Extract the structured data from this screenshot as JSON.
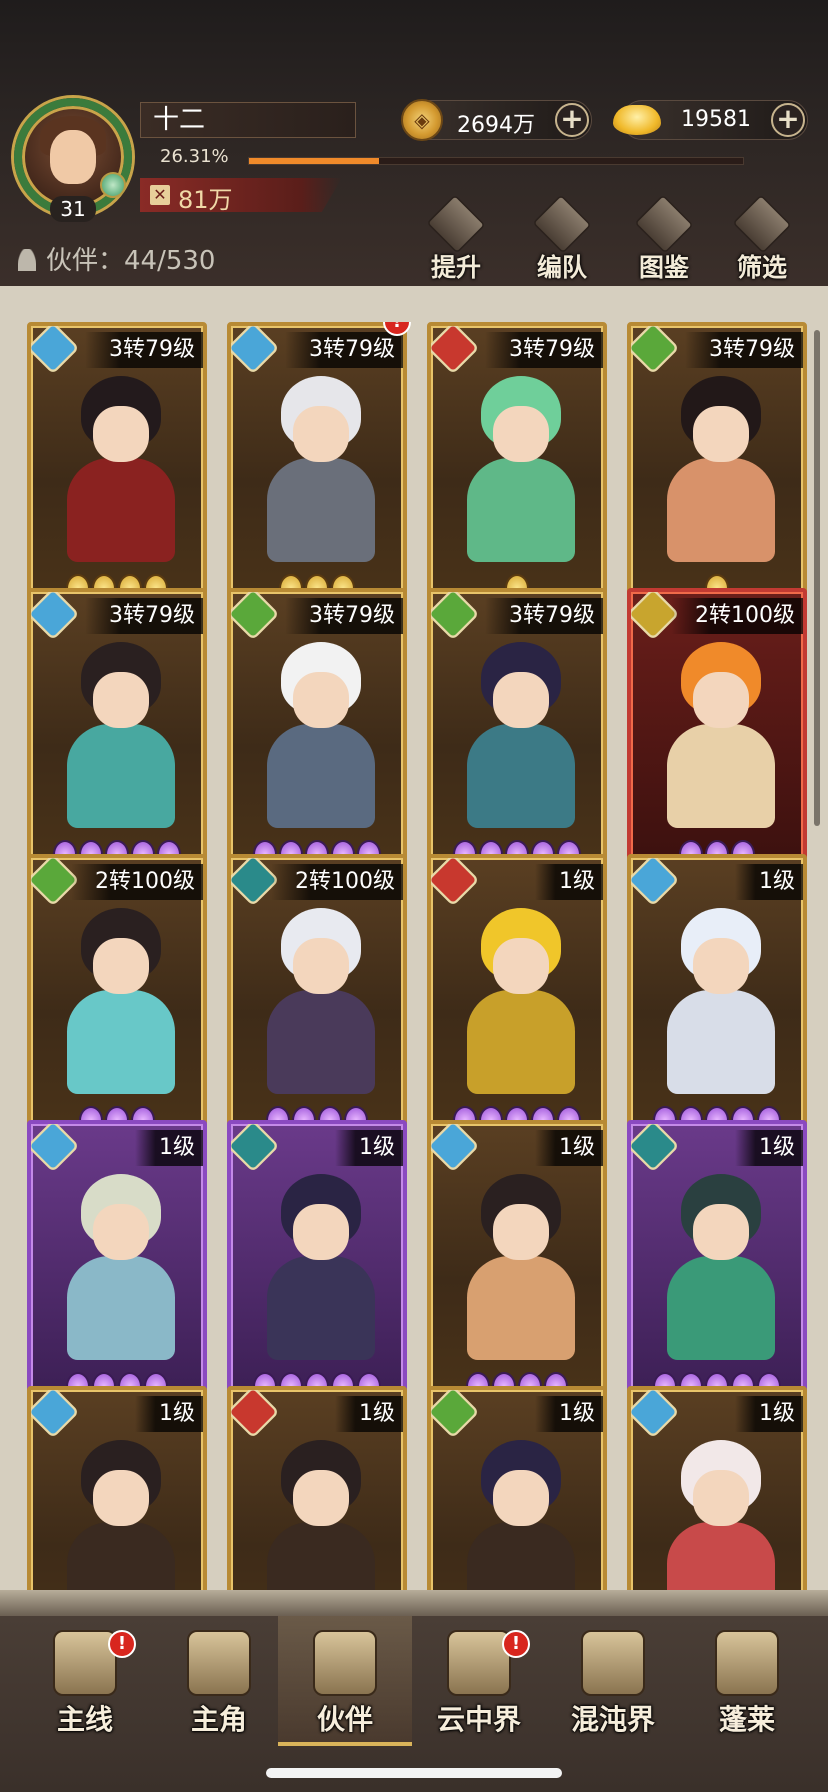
{
  "player": {
    "name": "十二",
    "level": "31",
    "xp_percent": "26.31%",
    "xp_fraction": 0.2631,
    "power": "81万"
  },
  "currency": {
    "coins": "2694万",
    "ingots": "19581"
  },
  "companions": {
    "label": "伙伴：44/530"
  },
  "actions": [
    {
      "label": "提升",
      "icon": "upgrade-icon"
    },
    {
      "label": "编队",
      "icon": "formation-flag-icon"
    },
    {
      "label": "图鉴",
      "icon": "scroll-codex-icon"
    },
    {
      "label": "筛选",
      "icon": "filter-icon"
    }
  ],
  "cards": [
    {
      "level": "3转79级",
      "frame": "gold",
      "element": "water",
      "elemColor": "#4aa6d8",
      "starType": "gold",
      "stars": 4,
      "alert": false,
      "hair": "#231a1c",
      "body": "#8a2220"
    },
    {
      "level": "3转79级",
      "frame": "gold",
      "element": "water",
      "elemColor": "#4aa6d8",
      "starType": "gold",
      "stars": 3,
      "alert": true,
      "hair": "#e6e6ea",
      "body": "#6a6f7a"
    },
    {
      "level": "3转79级",
      "frame": "gold",
      "element": "fire",
      "elemColor": "#c8382e",
      "starType": "gold",
      "stars": 1,
      "alert": false,
      "hair": "#6fcf9a",
      "body": "#5fb888"
    },
    {
      "level": "3转79级",
      "frame": "gold",
      "element": "wood",
      "elemColor": "#5aa83a",
      "starType": "gold",
      "stars": 1,
      "alert": false,
      "hair": "#221818",
      "body": "#d8926a"
    },
    {
      "level": "3转79级",
      "frame": "gold",
      "element": "water",
      "elemColor": "#4aa6d8",
      "starType": "purple",
      "stars": 5,
      "alert": false,
      "hair": "#2a2020",
      "body": "#48a8a0"
    },
    {
      "level": "3转79级",
      "frame": "gold",
      "element": "wood",
      "elemColor": "#5aa83a",
      "starType": "purple",
      "stars": 5,
      "alert": false,
      "hair": "#f2f2f2",
      "body": "#5a6a80"
    },
    {
      "level": "3转79级",
      "frame": "gold",
      "element": "wood",
      "elemColor": "#5aa83a",
      "starType": "purple",
      "stars": 5,
      "alert": false,
      "hair": "#2a2444",
      "body": "#3c7a86"
    },
    {
      "level": "2转100级",
      "frame": "red",
      "element": "earth",
      "elemColor": "#c8a52e",
      "starType": "purple",
      "stars": 3,
      "alert": false,
      "hair": "#f08a2a",
      "body": "#e8d0a8"
    },
    {
      "level": "2转100级",
      "frame": "gold",
      "element": "wood",
      "elemColor": "#5aa83a",
      "starType": "purple",
      "stars": 3,
      "alert": false,
      "hair": "#2a2020",
      "body": "#68c8c8"
    },
    {
      "level": "2转100级",
      "frame": "gold",
      "element": "dark",
      "elemColor": "#2a8a8a",
      "starType": "purple",
      "stars": 4,
      "alert": false,
      "hair": "#e8eaf0",
      "body": "#4a3a5a"
    },
    {
      "level": "1级",
      "frame": "gold",
      "element": "fire",
      "elemColor": "#c8382e",
      "starType": "purple",
      "stars": 5,
      "alert": false,
      "hair": "#f0c62a",
      "body": "#c8a02a"
    },
    {
      "level": "1级",
      "frame": "gold",
      "element": "water",
      "elemColor": "#4aa6d8",
      "starType": "purple",
      "stars": 5,
      "alert": false,
      "hair": "#e8eef8",
      "body": "#d8dde8"
    },
    {
      "level": "1级",
      "frame": "purple",
      "element": "water",
      "elemColor": "#4aa6d8",
      "starType": "purple",
      "stars": 4,
      "alert": false,
      "hair": "#d8dcc8",
      "body": "#8ab8c8"
    },
    {
      "level": "1级",
      "frame": "purple",
      "element": "dark",
      "elemColor": "#2a8a8a",
      "starType": "purple",
      "stars": 5,
      "alert": false,
      "hair": "#2a2444",
      "body": "#3a3458"
    },
    {
      "level": "1级",
      "frame": "gold",
      "element": "water",
      "elemColor": "#4aa6d8",
      "starType": "purple",
      "stars": 4,
      "alert": false,
      "hair": "#2a2020",
      "body": "#d8a070"
    },
    {
      "level": "1级",
      "frame": "purple",
      "element": "dark",
      "elemColor": "#2a8a8a",
      "starType": "purple",
      "stars": 5,
      "alert": false,
      "hair": "#2a4040",
      "body": "#3a9a78"
    },
    {
      "level": "1级",
      "frame": "gold",
      "element": "water",
      "elemColor": "#4aa6d8",
      "starType": "purple",
      "stars": 0,
      "alert": false,
      "hair": "#2a2020",
      "body": "#3a2a20"
    },
    {
      "level": "1级",
      "frame": "gold",
      "element": "fire",
      "elemColor": "#c8382e",
      "starType": "purple",
      "stars": 0,
      "alert": false,
      "hair": "#2a2020",
      "body": "#3a2a20"
    },
    {
      "level": "1级",
      "frame": "gold",
      "element": "wood",
      "elemColor": "#5aa83a",
      "starType": "purple",
      "stars": 0,
      "alert": false,
      "hair": "#2a2444",
      "body": "#3a2a20"
    },
    {
      "level": "1级",
      "frame": "gold",
      "element": "water",
      "elemColor": "#4aa6d8",
      "starType": "purple",
      "stars": 0,
      "alert": false,
      "hair": "#f2e8e8",
      "body": "#c84a4a"
    }
  ],
  "nav": [
    {
      "label": "主线",
      "alert": true,
      "active": false,
      "icon": "crossed-swords-icon"
    },
    {
      "label": "主角",
      "alert": false,
      "active": false,
      "icon": "hero-portrait-icon"
    },
    {
      "label": "伙伴",
      "alert": false,
      "active": true,
      "icon": "crown-icon"
    },
    {
      "label": "云中界",
      "alert": true,
      "active": false,
      "icon": "pavilion-icon"
    },
    {
      "label": "混沌界",
      "alert": false,
      "active": false,
      "icon": "chaos-tower-icon"
    },
    {
      "label": "蓬莱",
      "alert": false,
      "active": false,
      "icon": "sage-icon"
    }
  ]
}
